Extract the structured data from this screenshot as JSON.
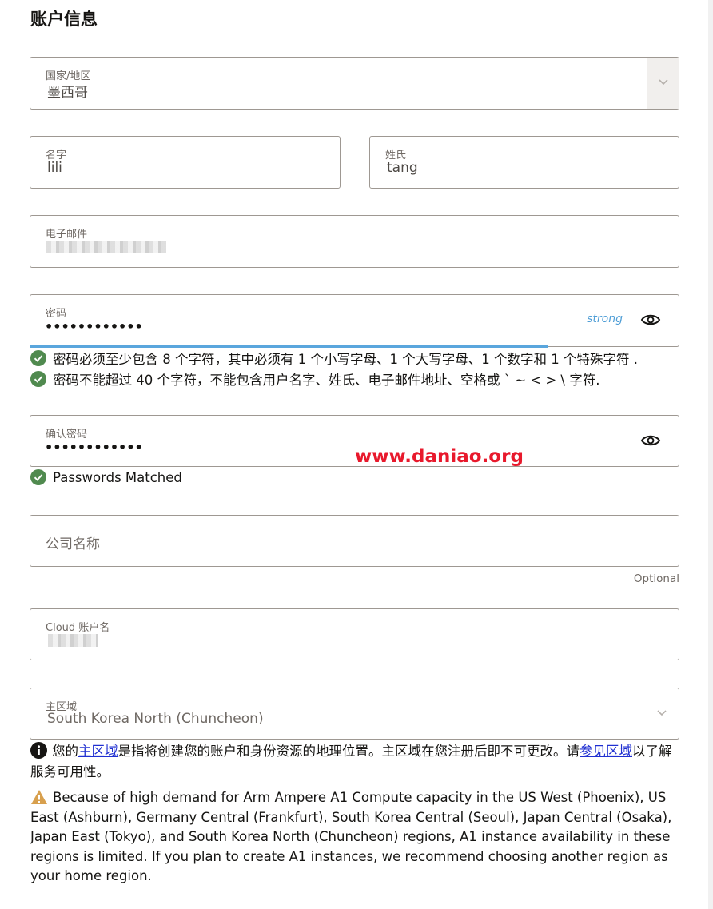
{
  "section_title": "账户信息",
  "country": {
    "label": "国家/地区",
    "value": "墨西哥"
  },
  "first_name": {
    "label": "名字",
    "value": "lili"
  },
  "last_name": {
    "label": "姓氏",
    "value": "tang"
  },
  "email": {
    "label": "电子邮件"
  },
  "password": {
    "label": "密码",
    "value": "••••••••••••",
    "strength": "strong"
  },
  "password_rules": [
    "密码必须至少包含 8 个字符，其中必须有 1 个小写字母、1 个大写字母、1 个数字和 1 个特殊字符 .",
    "密码不能超过 40 个字符，不能包含用户名字、姓氏、电子邮件地址、空格或 ` ~ < > \\ 字符."
  ],
  "confirm_password": {
    "label": "确认密码",
    "value": "••••••••••••",
    "match_text": "Passwords Matched"
  },
  "watermark": "www.daniao.org",
  "company": {
    "placeholder": "公司名称",
    "optional_text": "Optional"
  },
  "cloud_account": {
    "label": "Cloud 账户名"
  },
  "home_region": {
    "label": "主区域",
    "value": "South Korea North (Chuncheon)"
  },
  "home_region_info": {
    "part1": "您的",
    "link1": "主区域",
    "part2": "是指将创建您的账户和身份资源的地理位置。主区域在您注册后即不可更改。请",
    "link2": "参见区域",
    "part3": "以了解服务可用性。"
  },
  "a1_warning": "Because of high demand for Arm Ampere A1 Compute capacity in the US West (Phoenix), US East (Ashburn), Germany Central (Frankfurt), South Korea Central (Seoul), Japan Central (Osaka), Japan East (Tokyo), and South Korea North (Chuncheon) regions, A1 instance availability in these regions is limited. If you plan to create A1 instances, we recommend choosing another region as your home region.",
  "colors": {
    "check_green": "#508a4f",
    "link_blue": "#1f2fd1",
    "strength_blue": "#4f9ed6",
    "watermark_red": "#e8192c",
    "warning_orange": "#d8a04e"
  },
  "icons": [
    "chevron-down-icon",
    "eye-icon",
    "check-circle-icon",
    "info-icon",
    "warning-icon"
  ]
}
